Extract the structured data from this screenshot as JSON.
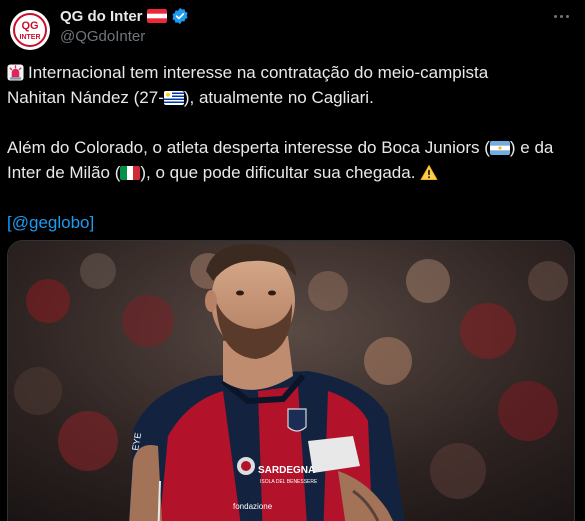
{
  "author": {
    "display_name": "QG do Inter",
    "handle": "@QGdoInter",
    "avatar_text": "QG INTER",
    "verified_icon": "verified-badge-icon",
    "flag_icon": "flag-austria-icon"
  },
  "tweet": {
    "line1_siren_icon": "police-siren-icon",
    "line1_text": "Internacional tem interesse na contratação do meio-campista",
    "line2_text_a": "Nahitan Nández (27-",
    "line2_flag_icon": "flag-uruguay-icon",
    "line2_text_b": "), atualmente no Cagliari.",
    "line3_text_a": "Além do Colorado, o atleta desperta interesse do Boca Juniors (",
    "line3_flag_icon": "flag-argentina-icon",
    "line3_text_b": ") e da",
    "line4_text_a": "Inter de Milão (",
    "line4_flag_icon": "flag-italy-icon",
    "line4_text_b": "), o que pode dificultar sua chegada. ",
    "line4_warning_icon": "warning-icon",
    "source_open": "[",
    "source_link": "@geglobo",
    "source_close": "]"
  },
  "media": {
    "sponsor_text": "SARDEGNA",
    "sponsor_sub": "ISOLA DEL BENESSERE",
    "sponsor2_text": "fondazione"
  },
  "colors": {
    "background": "#000000",
    "text": "#e7e9ea",
    "muted": "#71767b",
    "link": "#1d9bf0",
    "verified": "#1d9bf0",
    "jersey_red": "#b3122b",
    "jersey_navy": "#13233f"
  }
}
